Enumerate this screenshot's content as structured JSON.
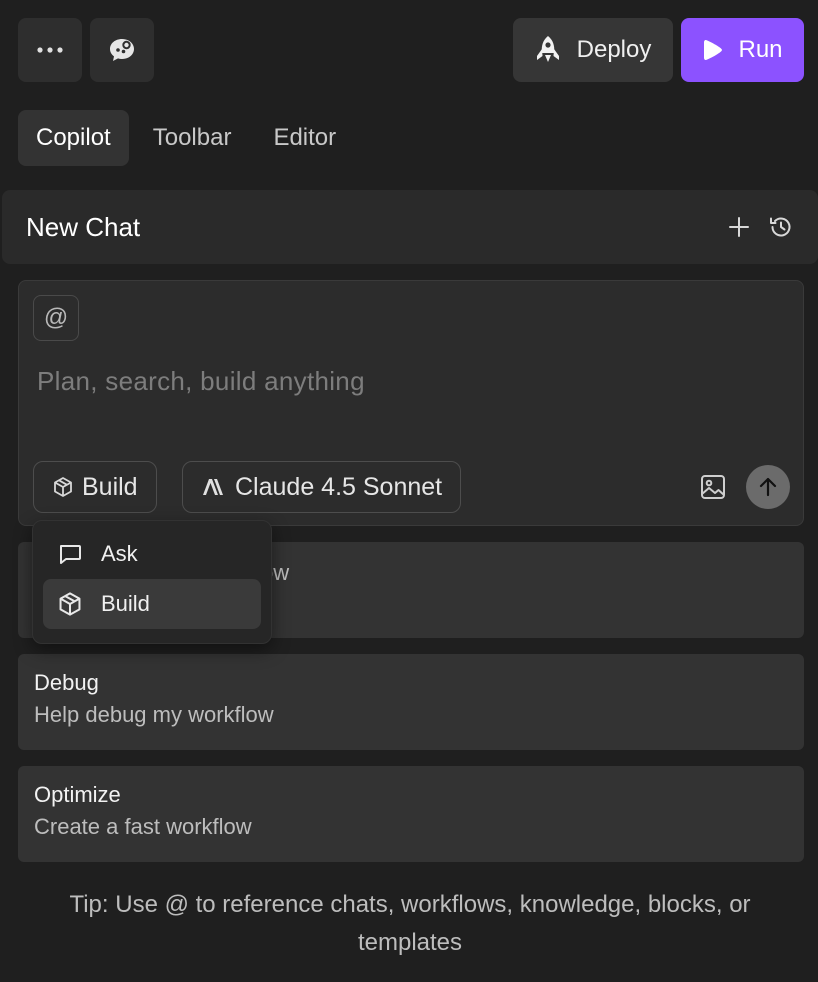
{
  "header": {
    "more_icon": "more-horizontal-icon",
    "chat_bot_icon": "chat-bubble-icon",
    "deploy_label": "Deploy",
    "run_label": "Run"
  },
  "tabs": [
    {
      "label": "Copilot",
      "active": true
    },
    {
      "label": "Toolbar",
      "active": false
    },
    {
      "label": "Editor",
      "active": false
    }
  ],
  "panel": {
    "title": "New Chat",
    "new_icon": "plus-icon",
    "history_icon": "history-icon"
  },
  "composer": {
    "mention_symbol": "@",
    "placeholder": "Plan, search, build anything",
    "value": "",
    "mode_label": "Build",
    "model_label": "Claude 4.5 Sonnet"
  },
  "mode_menu": {
    "items": [
      {
        "label": "Ask",
        "icon": "message-square-icon",
        "selected": false
      },
      {
        "label": "Build",
        "icon": "package-icon",
        "selected": true
      }
    ]
  },
  "suggestions": [
    {
      "title": "",
      "subtitle": "flow"
    },
    {
      "title": "Debug",
      "subtitle": "Help debug my workflow"
    },
    {
      "title": "Optimize",
      "subtitle": "Create a fast workflow"
    }
  ],
  "tip": "Tip: Use @ to reference chats, workflows, knowledge, blocks, or templates",
  "colors": {
    "accent": "#8c52ff",
    "background": "#1f1f1f"
  }
}
